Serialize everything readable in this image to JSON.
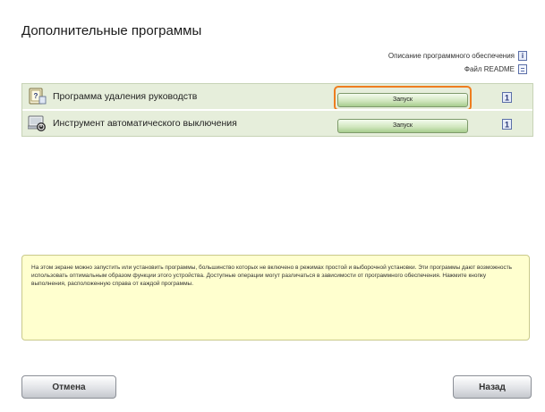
{
  "page": {
    "title": "Дополнительные программы"
  },
  "top_links": {
    "software_description": "Описание программного обеспечения",
    "readme_file": "Файл README"
  },
  "programs": [
    {
      "name": "Программа удаления руководств",
      "button_label": "Запуск",
      "icon": "manual-uninstall-icon",
      "highlighted": true
    },
    {
      "name": "Инструмент автоматического выключения",
      "button_label": "Запуск",
      "icon": "auto-shutdown-icon",
      "highlighted": false
    }
  ],
  "message": {
    "text": "На этом экране можно запустить или установить программы, большинство которых не включено в режимах простой и выборочной установки. Эти программы дают возможность использовать оптимальным образом функции этого устройства. Доступные операции могут различаться в зависимости от программного обеспечения. Нажмите кнопку выполнения, расположенную справа от каждой программы."
  },
  "buttons": {
    "cancel": "Отмена",
    "back": "Назад"
  },
  "colors": {
    "row_bg": "#e6eedb",
    "highlight": "#ee7d1f",
    "message_bg": "#ffffcf"
  }
}
